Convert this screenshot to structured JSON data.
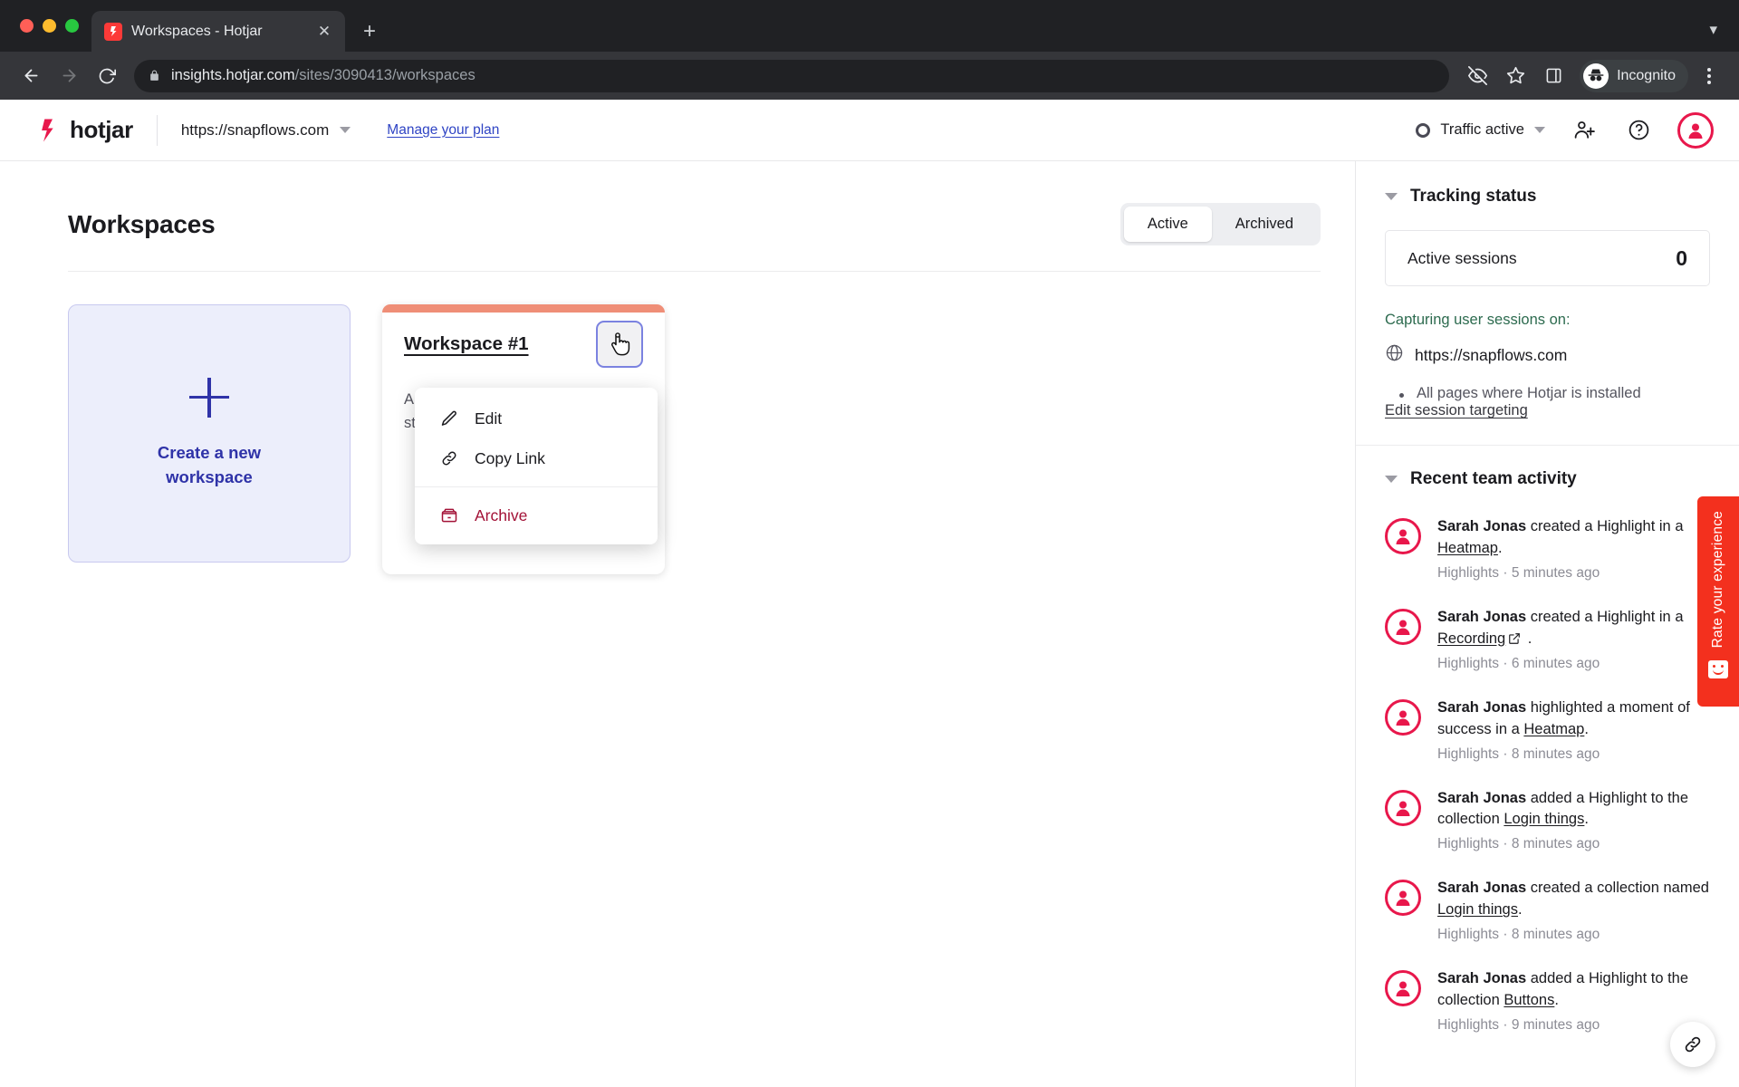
{
  "browser": {
    "tab": {
      "title": "Workspaces - Hotjar",
      "favicon": "hotjar-favicon",
      "close_label": "✕"
    },
    "new_tab_label": "+",
    "tabstrip_collapse_icon": "chevron-down-icon",
    "url": {
      "host": "insights.hotjar.com",
      "path": "/sites/3090413/workspaces",
      "lock_icon": "lock-icon"
    },
    "nav": {
      "back": "back-arrow-icon",
      "forward": "forward-arrow-icon",
      "reload": "reload-icon"
    },
    "toolbar_icons": [
      "eye-off-icon",
      "star-icon",
      "side-panel-icon"
    ],
    "profile": {
      "label": "Incognito",
      "icon": "incognito-icon"
    },
    "menu_icon": "three-dot-menu-icon"
  },
  "app_header": {
    "brand": "hotjar",
    "site_url": "https://snapflows.com",
    "site_caret": "chevron-down-icon",
    "manage_plan": "Manage your plan",
    "traffic_status": "Traffic active",
    "traffic_caret": "chevron-down-icon",
    "invite_icon": "add-user-icon",
    "help_icon": "help-circle-icon",
    "avatar_icon": "user-avatar-icon"
  },
  "main": {
    "title": "Workspaces",
    "segments": [
      {
        "label": "Active",
        "active": true
      },
      {
        "label": "Archived",
        "active": false
      }
    ],
    "create_card": {
      "icon": "plus-icon",
      "label": "Create a new\nworkspace"
    },
    "workspace": {
      "name": "Workspace #1",
      "description": "A workspace to help you get started.",
      "menu_button_icon": "pointer-hand-cursor-icon",
      "accent_color": "#ef8e77"
    },
    "context_menu": {
      "items": [
        {
          "label": "Edit",
          "icon": "pencil-icon",
          "danger": false
        },
        {
          "label": "Copy Link",
          "icon": "link-icon",
          "danger": false
        },
        {
          "label": "Archive",
          "icon": "archive-box-icon",
          "danger": true
        }
      ],
      "danger_color": "#a31237"
    }
  },
  "sidebar": {
    "tracking": {
      "title": "Tracking status",
      "collapse_icon": "triangle-down-icon",
      "sessions_label": "Active sessions",
      "sessions_count": "0",
      "capturing_label": "Capturing user sessions on:",
      "capturing_url": "https://snapflows.com",
      "globe_icon": "globe-icon",
      "bullet": "All pages where Hotjar is installed",
      "edit_link": "Edit session targeting",
      "capturing_color": "#2d6b4f"
    },
    "activity": {
      "title": "Recent team activity",
      "collapse_icon": "triangle-down-icon",
      "items": [
        {
          "actor": "Sarah Jonas",
          "before": " created a Highlight in a ",
          "link": "Heatmap",
          "after": ".",
          "external": false,
          "meta": "Highlights · 5 minutes ago"
        },
        {
          "actor": "Sarah Jonas",
          "before": " created a Highlight in a ",
          "link": "Recording",
          "after": ".",
          "external": true,
          "meta": "Highlights · 6 minutes ago"
        },
        {
          "actor": "Sarah Jonas",
          "before": " highlighted a moment of success in a ",
          "link": "Heatmap",
          "after": ".",
          "external": false,
          "meta": "Highlights · 8 minutes ago"
        },
        {
          "actor": "Sarah Jonas",
          "before": " added a Highlight to the collection ",
          "link": "Login things",
          "after": ".",
          "external": false,
          "meta": "Highlights · 8 minutes ago"
        },
        {
          "actor": "Sarah Jonas",
          "before": " created a collection named ",
          "link": "Login things",
          "after": ".",
          "external": false,
          "meta": "Highlights · 8 minutes ago"
        },
        {
          "actor": "Sarah Jonas",
          "before": " added a Highlight to the collection ",
          "link": "Buttons",
          "after": ".",
          "external": false,
          "meta": "Highlights · 9 minutes ago"
        }
      ]
    },
    "rate_tab": {
      "label": "Rate your experience",
      "icon": "smiley-face-icon",
      "color": "#f3301e"
    },
    "fab": {
      "icon": "link-icon"
    }
  }
}
